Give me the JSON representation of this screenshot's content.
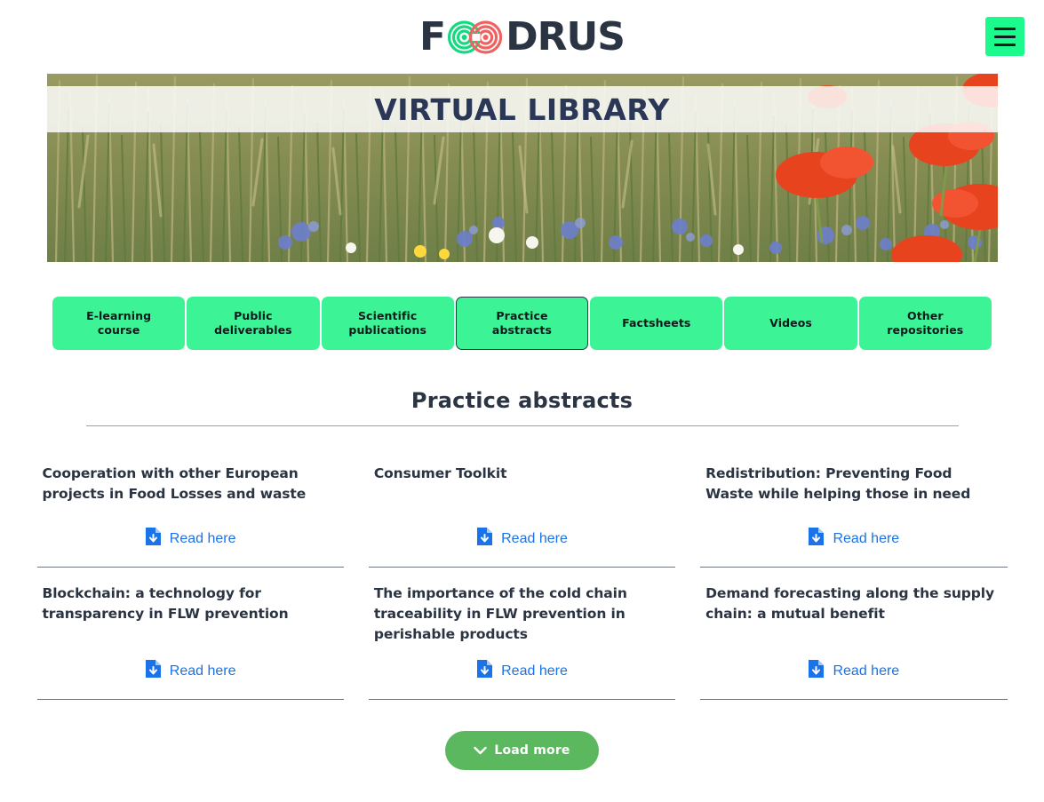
{
  "header": {
    "logo_text_start": "F",
    "logo_text_end": "DRUS",
    "logo_alt": "FOODRUS",
    "menu_label": "Menu",
    "colors": {
      "menu_bg": "#1cf98d",
      "logo_ring_green": "#15d97e",
      "logo_ring_red": "#f0615f",
      "logo_dark": "#2b3442"
    }
  },
  "hero": {
    "title": "VIRTUAL LIBRARY",
    "image_alt": "wheat field with cornflowers, daisies and red poppies"
  },
  "tabs": {
    "active_index": 3,
    "items": [
      {
        "label": "E-learning\ncourse"
      },
      {
        "label": "Public\ndeliverables"
      },
      {
        "label": "Scientific\npublications"
      },
      {
        "label": "Practice\nabstracts"
      },
      {
        "label": "Factsheets"
      },
      {
        "label": "Videos"
      },
      {
        "label": "Other\nrepositories"
      }
    ]
  },
  "section": {
    "title": "Practice abstracts"
  },
  "cards": [
    {
      "title": "Cooperation with other European projects in Food Losses and waste",
      "link_label": "Read here",
      "icon": "file-download-icon"
    },
    {
      "title": "Consumer Toolkit",
      "link_label": "Read here",
      "icon": "file-download-icon"
    },
    {
      "title": "Redistribution: Preventing Food Waste while helping those in need",
      "link_label": "Read here",
      "icon": "file-download-icon"
    },
    {
      "title": "Blockchain: a technology for transparency in FLW prevention",
      "link_label": "Read here",
      "icon": "file-download-icon"
    },
    {
      "title": "The importance of the cold chain traceability in FLW prevention in perishable products",
      "link_label": "Read here",
      "icon": "file-download-icon"
    },
    {
      "title": "Demand forecasting along the supply chain: a mutual benefit",
      "link_label": "Read here",
      "icon": "file-download-icon"
    }
  ],
  "load_more": {
    "label": "Load more",
    "icon": "chevron-down-icon",
    "color": "#5cb85f"
  },
  "link_color": "#1a73e8"
}
